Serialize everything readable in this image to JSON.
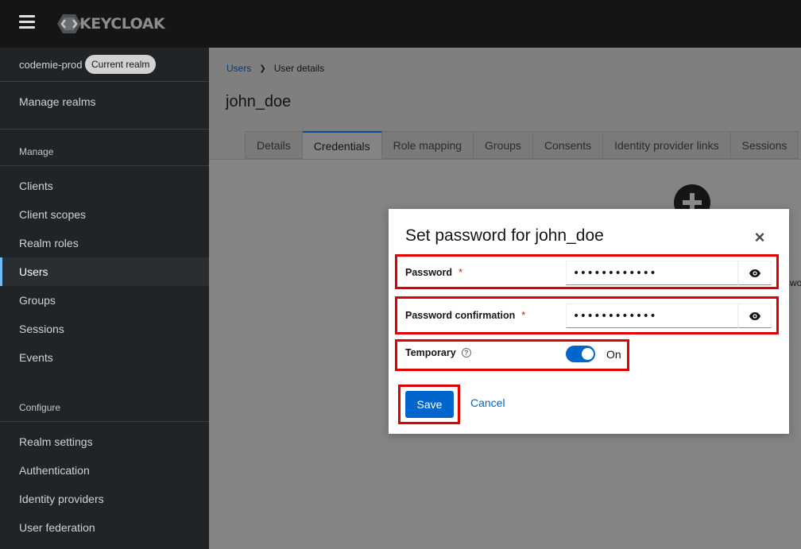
{
  "header": {
    "logo_text": "KEYCLOAK",
    "menu_icon": "hamburger-menu-icon"
  },
  "sidebar": {
    "realm_name": "codemie-prod",
    "realm_badge": "Current realm",
    "manage_realms": "Manage realms",
    "section_manage": "Manage",
    "manage_items": [
      {
        "label": "Clients"
      },
      {
        "label": "Client scopes"
      },
      {
        "label": "Realm roles"
      },
      {
        "label": "Users"
      },
      {
        "label": "Groups"
      },
      {
        "label": "Sessions"
      },
      {
        "label": "Events"
      }
    ],
    "section_configure": "Configure",
    "configure_items": [
      {
        "label": "Realm settings"
      },
      {
        "label": "Authentication"
      },
      {
        "label": "Identity providers"
      },
      {
        "label": "User federation"
      }
    ],
    "active_item": "Users"
  },
  "breadcrumb": {
    "parent": "Users",
    "current": "User details"
  },
  "page": {
    "title": "john_doe",
    "tabs": [
      {
        "label": "Details"
      },
      {
        "label": "Credentials"
      },
      {
        "label": "Role mapping"
      },
      {
        "label": "Groups"
      },
      {
        "label": "Consents"
      },
      {
        "label": "Identity provider links"
      },
      {
        "label": "Sessions"
      }
    ],
    "active_tab": "Credentials",
    "background_partial_text": "swo"
  },
  "modal": {
    "title": "Set password for john_doe",
    "password_label": "Password",
    "password_value": "••••••••••••",
    "confirm_label": "Password confirmation",
    "confirm_value": "••••••••••••",
    "required_marker": "*",
    "temporary_label": "Temporary",
    "temporary_on": true,
    "temporary_state_label": "On",
    "save_label": "Save",
    "cancel_label": "Cancel",
    "close_glyph": "×"
  },
  "colors": {
    "primary": "#0066cc",
    "highlight": "#e00000",
    "topbar": "#151515",
    "sidebar": "#212427"
  }
}
